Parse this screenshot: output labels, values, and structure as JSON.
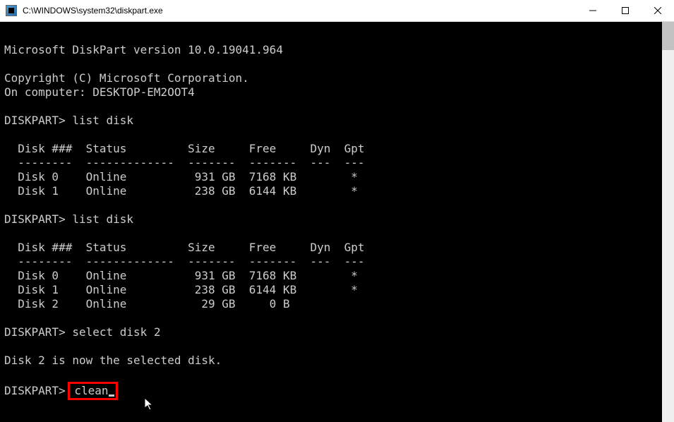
{
  "window": {
    "title": "C:\\WINDOWS\\system32\\diskpart.exe"
  },
  "terminal": {
    "version_line": "Microsoft DiskPart version 10.0.19041.964",
    "copyright_line": "Copyright (C) Microsoft Corporation.",
    "computer_line": "On computer: DESKTOP-EM2OOT4",
    "prompt": "DISKPART>",
    "cmd_list1": "list disk",
    "table1_header": "  Disk ###  Status         Size     Free     Dyn  Gpt",
    "table1_divider": "  --------  -------------  -------  -------  ---  ---",
    "table1_row0": "  Disk 0    Online          931 GB  7168 KB        *",
    "table1_row1": "  Disk 1    Online          238 GB  6144 KB        *",
    "cmd_list2": "list disk",
    "table2_header": "  Disk ###  Status         Size     Free     Dyn  Gpt",
    "table2_divider": "  --------  -------------  -------  -------  ---  ---",
    "table2_row0": "  Disk 0    Online          931 GB  7168 KB        *",
    "table2_row1": "  Disk 1    Online          238 GB  6144 KB        *",
    "table2_row2": "  Disk 2    Online           29 GB     0 B",
    "cmd_select": "select disk 2",
    "select_response": "Disk 2 is now the selected disk.",
    "cmd_clean": "clean"
  }
}
